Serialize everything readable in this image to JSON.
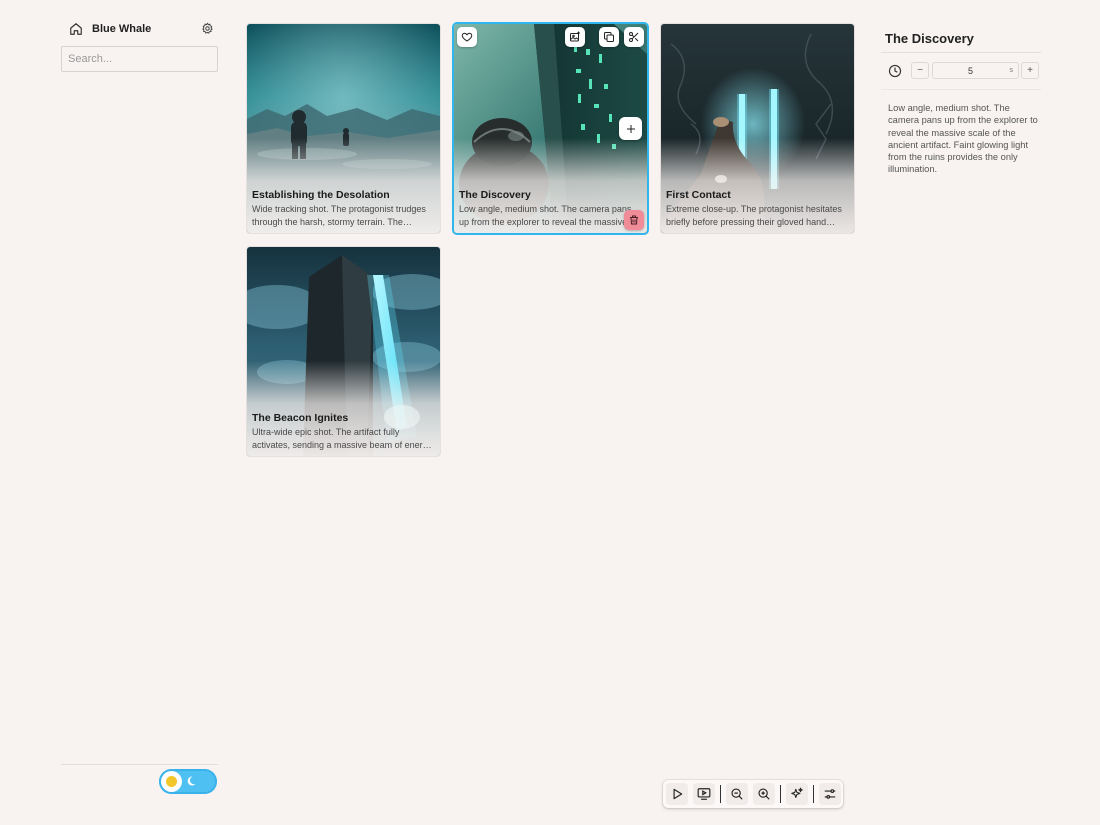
{
  "app": {
    "project_name": "Blue Whale",
    "search": {
      "placeholder": "Search...",
      "value": ""
    }
  },
  "colors": {
    "background": "#f8f3f1",
    "accent": "#2fb6ec",
    "delete": "#f08c97",
    "toggle": "#4fc0f2",
    "sun": "#f3c629"
  },
  "scenes": [
    {
      "title": "Establishing the Desolation",
      "description": "Wide tracking shot. The protagonist trudges through the harsh, stormy terrain. The camera follows as they push forward.",
      "selected": false
    },
    {
      "title": "The Discovery",
      "description": "Low angle, medium shot. The camera pans up from the explorer to reveal the massive scale of the ancient artifact.",
      "selected": true,
      "actions": [
        "heart-icon",
        "image-edit-icon",
        "copy-icon",
        "scissors-icon",
        "plus-icon",
        "trash-icon"
      ]
    },
    {
      "title": "First Contact",
      "description": "Extreme close-up. The protagonist hesitates briefly before pressing their gloved hand against the glowing glyphs.",
      "selected": false
    },
    {
      "title": "The Beacon Ignites",
      "description": "Ultra-wide epic shot. The artifact fully activates, sending a massive beam of energy piercing into the storm clouds.",
      "selected": false
    }
  ],
  "inspector": {
    "title": "The Discovery",
    "duration": {
      "value": "5",
      "unit": "s",
      "minus": "−",
      "plus": "+"
    },
    "description": "Low angle, medium shot. The camera pans up from the explorer to reveal the massive scale of the ancient artifact. Faint glowing light from the ruins provides the only illumination."
  },
  "toolbar": {
    "buttons": [
      "play-icon",
      "preview-icon",
      "zoom-out-icon",
      "zoom-in-icon",
      "sparkle-icon",
      "settings-sliders-icon"
    ]
  },
  "theme": {
    "mode": "light"
  }
}
